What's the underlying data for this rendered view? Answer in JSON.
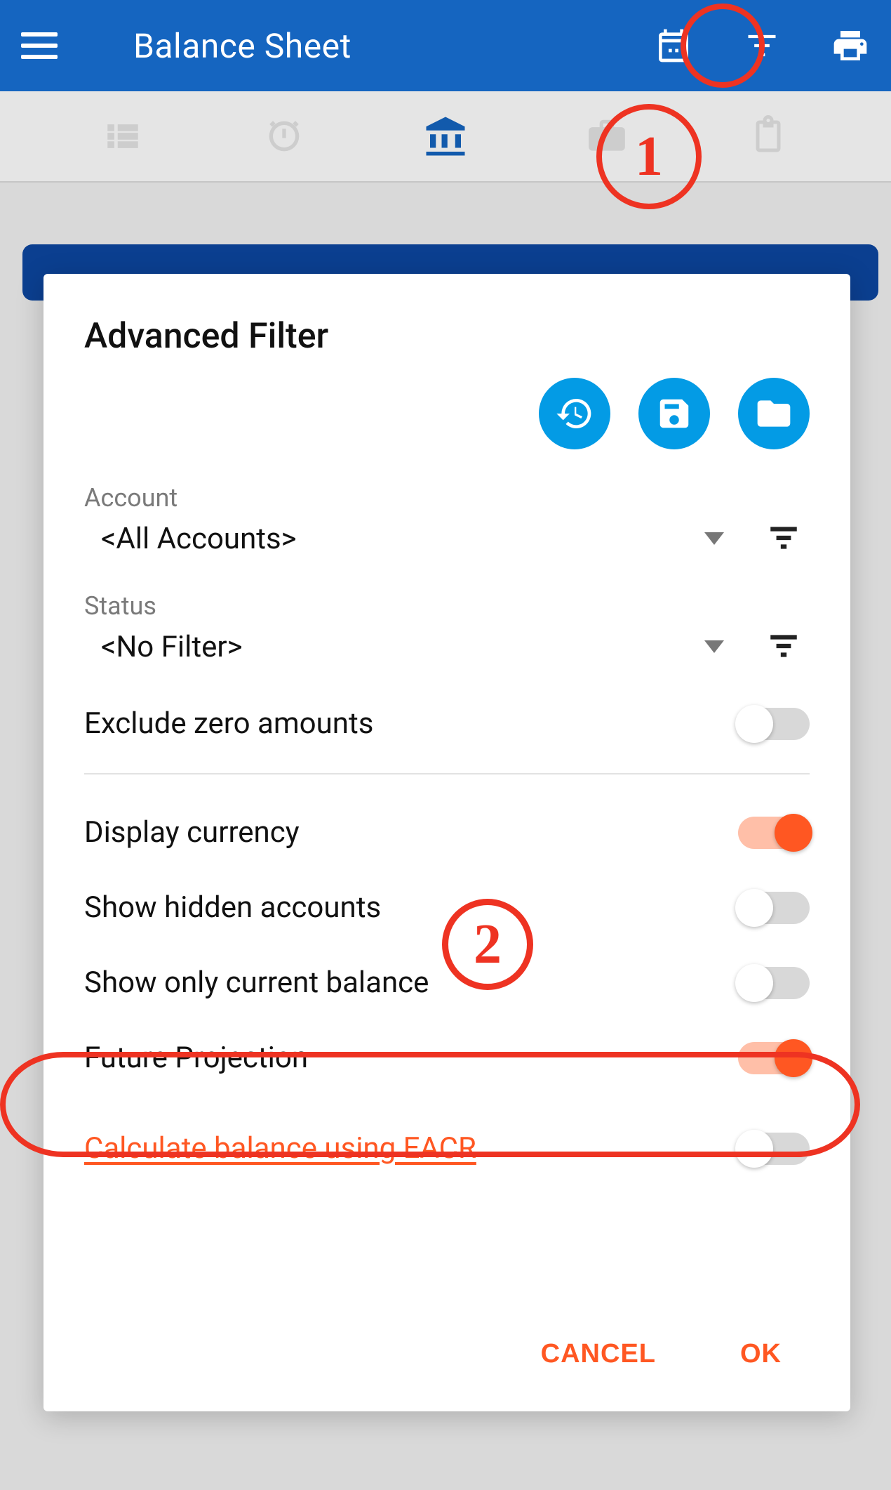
{
  "colors": {
    "primary": "#1565c0",
    "accent": "#ff5722",
    "circle_icon": "#039be5",
    "annotation": "#e32"
  },
  "header": {
    "title": "Balance Sheet"
  },
  "annotations": {
    "badge1": "1",
    "badge2": "2"
  },
  "dialog": {
    "title": "Advanced Filter",
    "account": {
      "label": "Account",
      "value": "<All Accounts>"
    },
    "status": {
      "label": "Status",
      "value": "<No Filter>"
    },
    "switches": {
      "exclude_zero": {
        "label": "Exclude zero amounts",
        "on": false
      },
      "display_currency": {
        "label": "Display currency",
        "on": true
      },
      "show_hidden": {
        "label": "Show hidden accounts",
        "on": false
      },
      "show_current": {
        "label": "Show only current balance",
        "on": false
      },
      "future_proj": {
        "label": "Future Projection",
        "on": true
      },
      "eacr": {
        "label": "Calculate balance using EACR",
        "on": false
      }
    },
    "buttons": {
      "cancel": "CANCEL",
      "ok": "OK"
    }
  }
}
